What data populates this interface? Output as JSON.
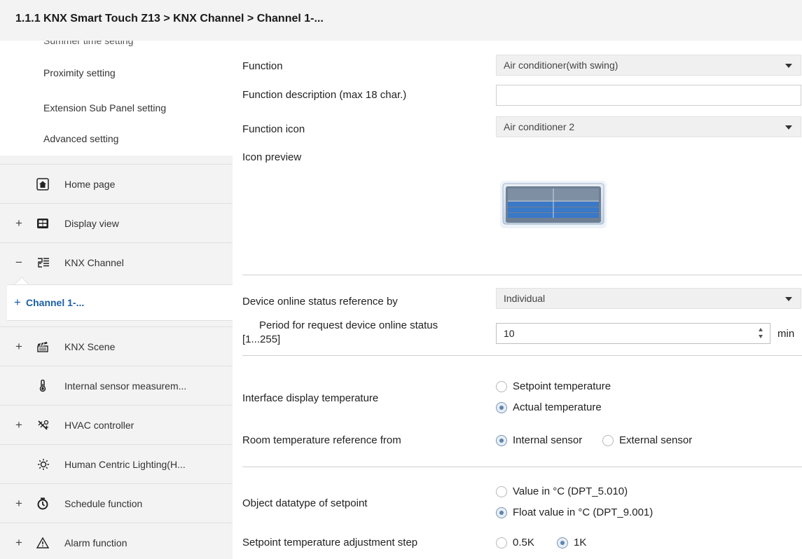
{
  "breadcrumb": "1.1.1 KNX Smart Touch Z13 > KNX Channel  > Channel 1-...",
  "sidebar": {
    "cut_off_item": "Summer time setting",
    "sub_items": [
      "Proximity setting",
      "Extension Sub Panel setting",
      "Advanced setting"
    ],
    "items": [
      {
        "expander": "",
        "icon": "home-icon",
        "label": "Home page"
      },
      {
        "expander": "+",
        "icon": "display-view-icon",
        "label": "Display view"
      },
      {
        "expander": "−",
        "icon": "knx-channel-icon",
        "label": "KNX Channel"
      },
      {
        "expander": "+",
        "icon": "",
        "label": "Channel 1-..."
      },
      {
        "expander": "+",
        "icon": "knx-scene-icon",
        "label": "KNX Scene"
      },
      {
        "expander": "",
        "icon": "thermometer-icon",
        "label": "Internal sensor measurem..."
      },
      {
        "expander": "+",
        "icon": "hvac-icon",
        "label": "HVAC controller"
      },
      {
        "expander": "",
        "icon": "sun-icon",
        "label": "Human Centric Lighting(H..."
      },
      {
        "expander": "+",
        "icon": "clock-icon",
        "label": "Schedule function"
      },
      {
        "expander": "+",
        "icon": "warning-icon",
        "label": "Alarm function"
      }
    ]
  },
  "main": {
    "function": {
      "label": "Function",
      "value": "Air conditioner(with swing)"
    },
    "function_description": {
      "label": "Function description (max 18 char.)",
      "value": ""
    },
    "function_icon": {
      "label": "Function icon",
      "value": "Air conditioner 2"
    },
    "icon_preview": {
      "label": "Icon preview",
      "icon": "air-conditioner-icon"
    },
    "online_status_ref": {
      "label": "Device online status reference by",
      "value": "Individual"
    },
    "request_period": {
      "label_line1": "Period for request device online status",
      "label_line2": "[1...255]",
      "value": "10",
      "unit": "min"
    },
    "interface_display_temp": {
      "label": "Interface display temperature",
      "options": [
        "Setpoint temperature",
        "Actual temperature"
      ],
      "selected": "Actual temperature"
    },
    "room_temp_ref": {
      "label": "Room temperature reference from",
      "options": [
        "Internal sensor",
        "External sensor"
      ],
      "selected": "Internal sensor"
    },
    "setpoint_datatype": {
      "label": "Object datatype of setpoint",
      "options": [
        "Value in °C (DPT_5.010)",
        "Float value in °C (DPT_9.001)"
      ],
      "selected": "Float value in °C (DPT_9.001)"
    },
    "setpoint_step": {
      "label": "Setpoint temperature adjustment step",
      "options": [
        "0.5K",
        "1K"
      ],
      "selected": "1K"
    }
  },
  "colors": {
    "accent": "#1a5fa8",
    "sidebar_bg": "#f3f3f3",
    "select_bg": "#f0f0f0",
    "radio_dot": "#5d84b4",
    "icon_blue": "#3a78c8"
  }
}
